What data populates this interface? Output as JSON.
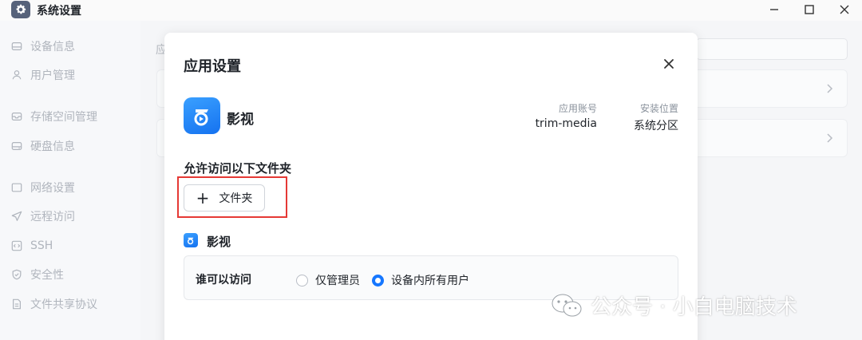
{
  "window": {
    "title": "系统设置"
  },
  "sidebar": {
    "items": [
      {
        "label": "设备信息",
        "icon": "device-icon"
      },
      {
        "label": "用户管理",
        "icon": "user-icon"
      },
      {
        "label": "存储空间管理",
        "icon": "storage-icon"
      },
      {
        "label": "硬盘信息",
        "icon": "disk-icon"
      },
      {
        "label": "网络设置",
        "icon": "network-icon"
      },
      {
        "label": "远程访问",
        "icon": "send-icon"
      },
      {
        "label": "SSH",
        "icon": "code-icon"
      },
      {
        "label": "安全性",
        "icon": "shield-icon"
      },
      {
        "label": "文件共享协议",
        "icon": "file-icon"
      }
    ]
  },
  "background": {
    "section_label": "应"
  },
  "dialog": {
    "title": "应用设置",
    "app_name": "影视",
    "account_label": "应用账号",
    "account_value": "trim-media",
    "location_label": "安装位置",
    "location_value": "系统分区",
    "folder_section_title": "允许访问以下文件夹",
    "add_folder_label": "文件夹",
    "access_app_name": "影视",
    "access_label": "谁可以访问",
    "options": [
      {
        "label": "仅管理员",
        "selected": false
      },
      {
        "label": "设备内所有用户",
        "selected": true
      }
    ]
  },
  "watermark": {
    "text": "公众号 · 小白电脑技术"
  },
  "colors": {
    "accent": "#1677ff",
    "highlight": "#e53935",
    "app_icon": "#1572f0"
  }
}
